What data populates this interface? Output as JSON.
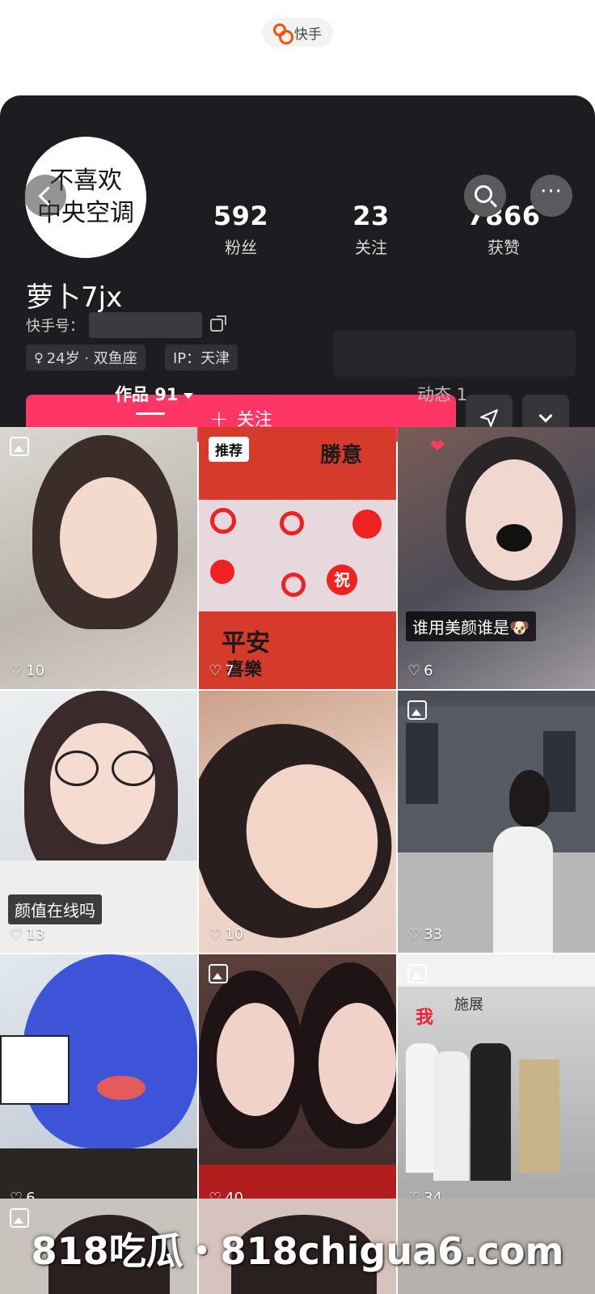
{
  "app": {
    "badge_label": "快手"
  },
  "avatar": {
    "line1": "不喜欢",
    "line2": "中央空调"
  },
  "stats": {
    "fans": {
      "value": "592",
      "label": "粉丝"
    },
    "following": {
      "value": "23",
      "label": "关注"
    },
    "likes": {
      "value": "7866",
      "label": "获赞"
    }
  },
  "profile": {
    "username": "萝卜7jx",
    "id_label": "快手号：",
    "tag_age": "24岁 · 双鱼座",
    "tag_ip": "IP：天津"
  },
  "actions": {
    "follow_label": "关注",
    "follow_plus": "+"
  },
  "tabs": {
    "works": "作品 91",
    "moments": "动态 1"
  },
  "grid": [
    {
      "likes": "10",
      "has_image_icon": true
    },
    {
      "likes": "7",
      "badge": "推荐",
      "title": "勝意",
      "text_bottom": "平安",
      "text_bottom2": "喜樂",
      "text_center": "祝"
    },
    {
      "likes": "6",
      "overlay": "谁用美颜谁是🐶"
    },
    {
      "likes": "13",
      "overlay": "颜值在线吗"
    },
    {
      "likes": "10"
    },
    {
      "likes": "33",
      "has_image_icon": true
    },
    {
      "likes": "6"
    },
    {
      "likes": "40",
      "has_image_icon": true
    },
    {
      "likes": "34",
      "has_image_icon": true,
      "text": "我",
      "text2": "施展"
    }
  ],
  "watermark": "818吃瓜・818chigua6.com",
  "colors": {
    "accent": "#fe3666",
    "header_bg": "#1c1c21"
  }
}
